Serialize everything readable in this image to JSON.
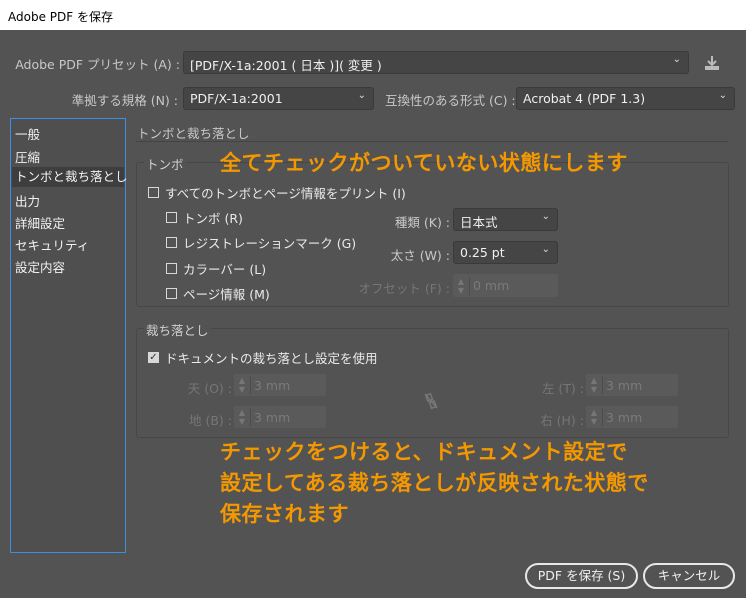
{
  "window": {
    "title": "Adobe PDF を保存"
  },
  "preset": {
    "label": "Adobe PDF プリセット (A) :",
    "value": "[PDF/X-1a:2001 ( 日本 )]( 変更 )",
    "icon": "save-preset-icon"
  },
  "standard": {
    "label": "準拠する規格 (N) :",
    "value": "PDF/X-1a:2001"
  },
  "compat": {
    "label": "互換性のある形式 (C) :",
    "value": "Acrobat 4 (PDF 1.3)"
  },
  "sidebar": {
    "items": [
      {
        "label": "一般"
      },
      {
        "label": "圧縮"
      },
      {
        "label": "トンボと裁ち落とし",
        "selected": true
      },
      {
        "label": "出力"
      },
      {
        "label": "詳細設定"
      },
      {
        "label": "セキュリティ"
      },
      {
        "label": "設定内容"
      }
    ]
  },
  "section": {
    "title": "トンボと裁ち落とし"
  },
  "marks": {
    "group_label": "トンボ",
    "all": {
      "label": "すべてのトンボとページ情報をプリント (I)",
      "checked": false
    },
    "items": [
      {
        "label": "トンボ (R)",
        "checked": false
      },
      {
        "label": "レジストレーションマーク (G)",
        "checked": false
      },
      {
        "label": "カラーバー (L)",
        "checked": false
      },
      {
        "label": "ページ情報 (M)",
        "checked": false
      }
    ],
    "type": {
      "label": "種類 (K) :",
      "value": "日本式"
    },
    "weight": {
      "label": "太さ (W) :",
      "value": "0.25 pt"
    },
    "offset": {
      "label": "オフセット (F) :",
      "value": "0 mm"
    }
  },
  "bleed": {
    "group_label": "裁ち落とし",
    "use_doc": {
      "label": "ドキュメントの裁ち落とし設定を使用",
      "checked": true
    },
    "top": {
      "label": "天 (O) :",
      "value": "3 mm"
    },
    "bottom": {
      "label": "地 (B) :",
      "value": "3 mm"
    },
    "left": {
      "label": "左 (T) :",
      "value": "3 mm"
    },
    "right": {
      "label": "右 (H) :",
      "value": "3 mm"
    }
  },
  "annotations": {
    "top": "全てチェックがついていない状態にします",
    "bottom": [
      "チェックをつけると、ドキュメント設定で",
      "設定してある裁ち落としが反映された状態で",
      "保存されます"
    ]
  },
  "buttons": {
    "save": "PDF を保存 (S)",
    "cancel": "キャンセル"
  },
  "colors": {
    "annotation": "#f39800",
    "focus": "#3d8ee0"
  }
}
